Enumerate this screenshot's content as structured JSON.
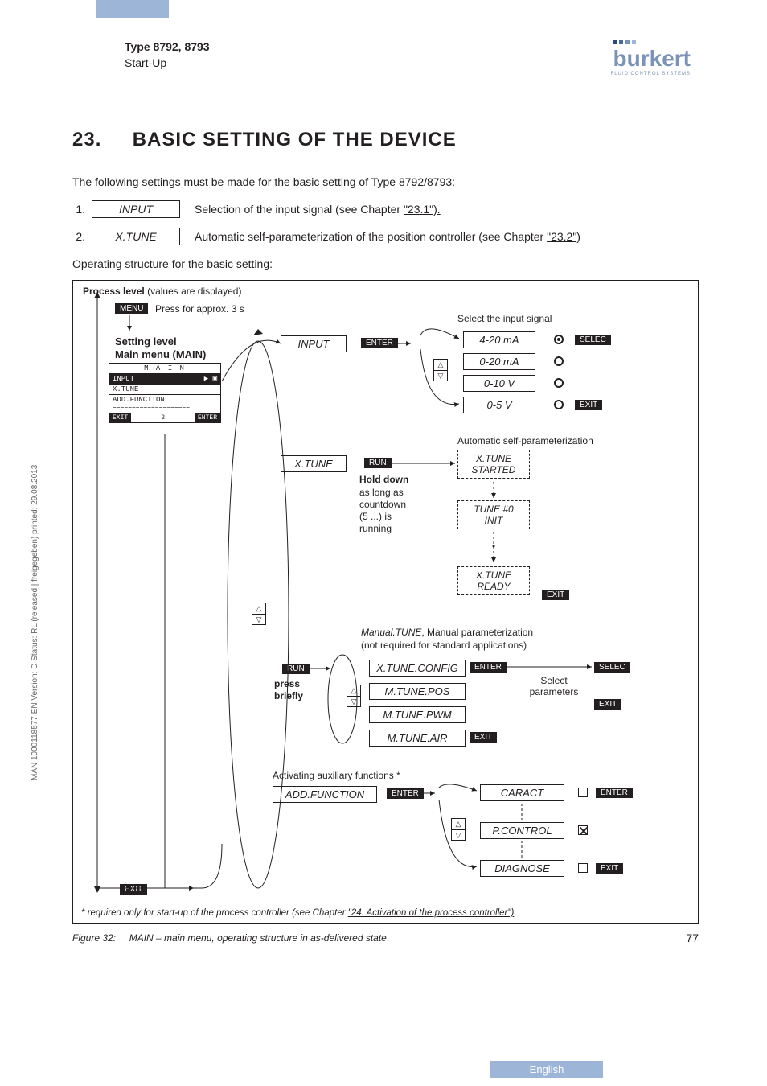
{
  "header": {
    "title": "Type 8792, 8793",
    "subtitle": "Start-Up",
    "logo_name": "burkert",
    "logo_tag": "FLUID CONTROL SYSTEMS"
  },
  "side_text": "MAN 1000118577 EN Version: D Status: RL (released | freigegeben) printed: 29.08.2013",
  "section": {
    "number": "23.",
    "title": "BASIC SETTING OF THE DEVICE",
    "intro": "The following settings must be made for the basic setting of Type 8792/8793:",
    "op_structure": "Operating structure for the basic setting:"
  },
  "steps": [
    {
      "num": "1.",
      "box": "INPUT",
      "desc_pre": "Selection of the input signal (see Chapter ",
      "link": "\"23.1\").",
      "desc_post": ""
    },
    {
      "num": "2.",
      "box": "X.TUNE",
      "desc_pre": "Automatic self-parameterization of the position controller (see Chapter ",
      "link": "\"23.2\")",
      "desc_post": ""
    }
  ],
  "diagram": {
    "process_level_label": "Process level",
    "process_level_suffix": "(values are displayed)",
    "menu_badge": "MENU",
    "menu_press": "Press for approx. 3 s",
    "setting_level": "Setting level",
    "main_menu": "Main menu (MAIN)",
    "lcd": {
      "title": "M A I N",
      "rows": [
        "INPUT",
        "X.TUNE",
        "ADD.FUNCTION"
      ],
      "bottom": [
        "EXIT",
        "2",
        "ENTER"
      ]
    },
    "input_node": "INPUT",
    "select_signal": "Select the input signal",
    "signal_options": [
      "4-20 mA",
      "0-20 mA",
      "0-10 V",
      "0-5 V"
    ],
    "btn_enter": "ENTER",
    "btn_selec": "SELEC",
    "btn_exit": "EXIT",
    "btn_run": "RUN",
    "xtune_node": "X.TUNE",
    "auto_self_param": "Automatic self-parameterization",
    "hold_down": "Hold down",
    "hold_down_lines": [
      "as long as",
      "countdown",
      "(5 ...) is",
      "running"
    ],
    "xtune_started": [
      "X.TUNE",
      "STARTED"
    ],
    "tune0": [
      "TUNE #0",
      "INIT"
    ],
    "xtune_ready": [
      "X.TUNE",
      "READY"
    ],
    "manual_tune_title": "Manual.TUNE",
    "manual_tune_desc": ", Manual parameterization",
    "manual_tune_sub": "(not required for standard applications)",
    "run_press": "press",
    "run_briefly": "briefly",
    "config_items": [
      "X.TUNE.CONFIG",
      "M.TUNE.POS",
      "M.TUNE.PWM",
      "M.TUNE.AIR"
    ],
    "select_params": [
      "Select",
      "parameters"
    ],
    "aux_title": "Activating auxiliary functions *",
    "add_function": "ADD.FUNCTION",
    "aux_items": [
      "CARACT",
      "P.CONTROL",
      "DIAGNOSE"
    ],
    "footnote_pre": "* required only for start-up of the process controller (see Chapter ",
    "footnote_link": "\"24. Activation of the process controller\")"
  },
  "figure": {
    "label": "Figure 32:",
    "caption": "MAIN – main menu, operating structure in as-delivered state",
    "page": "77"
  },
  "footer_lang": "English"
}
